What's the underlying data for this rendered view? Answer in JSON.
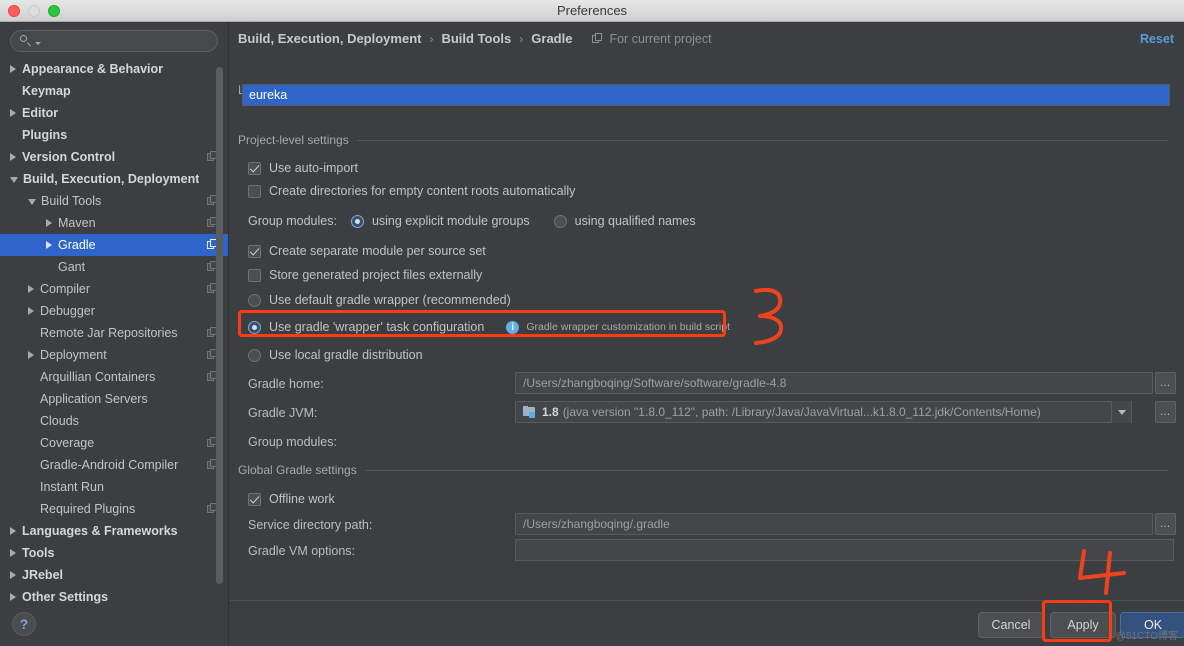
{
  "window": {
    "title": "Preferences",
    "traffic_lights": [
      "close",
      "minimize",
      "zoom"
    ]
  },
  "sidebar": {
    "search": {
      "value": "",
      "placeholder": ""
    },
    "items": [
      {
        "label": "Appearance & Behavior",
        "indent": 0,
        "arrow": "right",
        "bold": true,
        "badge": false,
        "selected": false
      },
      {
        "label": "Keymap",
        "indent": 0,
        "arrow": "none",
        "bold": true,
        "badge": false,
        "selected": false
      },
      {
        "label": "Editor",
        "indent": 0,
        "arrow": "right",
        "bold": true,
        "badge": false,
        "selected": false
      },
      {
        "label": "Plugins",
        "indent": 0,
        "arrow": "none",
        "bold": true,
        "badge": false,
        "selected": false
      },
      {
        "label": "Version Control",
        "indent": 0,
        "arrow": "right",
        "bold": true,
        "badge": true,
        "selected": false
      },
      {
        "label": "Build, Execution, Deployment",
        "indent": 0,
        "arrow": "down",
        "bold": true,
        "badge": false,
        "selected": false
      },
      {
        "label": "Build Tools",
        "indent": 1,
        "arrow": "down",
        "bold": false,
        "badge": true,
        "selected": false
      },
      {
        "label": "Maven",
        "indent": 2,
        "arrow": "right",
        "bold": false,
        "badge": true,
        "selected": false
      },
      {
        "label": "Gradle",
        "indent": 2,
        "arrow": "right",
        "bold": false,
        "badge": true,
        "selected": true
      },
      {
        "label": "Gant",
        "indent": 2,
        "arrow": "none",
        "bold": false,
        "badge": true,
        "selected": false
      },
      {
        "label": "Compiler",
        "indent": 1,
        "arrow": "right",
        "bold": false,
        "badge": true,
        "selected": false
      },
      {
        "label": "Debugger",
        "indent": 1,
        "arrow": "right",
        "bold": false,
        "badge": false,
        "selected": false
      },
      {
        "label": "Remote Jar Repositories",
        "indent": 1,
        "arrow": "none",
        "bold": false,
        "badge": true,
        "selected": false
      },
      {
        "label": "Deployment",
        "indent": 1,
        "arrow": "right",
        "bold": false,
        "badge": true,
        "selected": false
      },
      {
        "label": "Arquillian Containers",
        "indent": 1,
        "arrow": "none",
        "bold": false,
        "badge": true,
        "selected": false
      },
      {
        "label": "Application Servers",
        "indent": 1,
        "arrow": "none",
        "bold": false,
        "badge": false,
        "selected": false
      },
      {
        "label": "Clouds",
        "indent": 1,
        "arrow": "none",
        "bold": false,
        "badge": false,
        "selected": false
      },
      {
        "label": "Coverage",
        "indent": 1,
        "arrow": "none",
        "bold": false,
        "badge": true,
        "selected": false
      },
      {
        "label": "Gradle-Android Compiler",
        "indent": 1,
        "arrow": "none",
        "bold": false,
        "badge": true,
        "selected": false
      },
      {
        "label": "Instant Run",
        "indent": 1,
        "arrow": "none",
        "bold": false,
        "badge": false,
        "selected": false
      },
      {
        "label": "Required Plugins",
        "indent": 1,
        "arrow": "none",
        "bold": false,
        "badge": true,
        "selected": false
      },
      {
        "label": "Languages & Frameworks",
        "indent": 0,
        "arrow": "right",
        "bold": true,
        "badge": false,
        "selected": false
      },
      {
        "label": "Tools",
        "indent": 0,
        "arrow": "right",
        "bold": true,
        "badge": false,
        "selected": false
      },
      {
        "label": "JRebel",
        "indent": 0,
        "arrow": "right",
        "bold": true,
        "badge": false,
        "selected": false
      },
      {
        "label": "Other Settings",
        "indent": 0,
        "arrow": "right",
        "bold": true,
        "badge": false,
        "selected": false
      }
    ],
    "help_label": "?"
  },
  "header": {
    "crumbs": [
      "Build, Execution, Deployment",
      "Build Tools",
      "Gradle"
    ],
    "separator": "›",
    "for_current_project": "For current project",
    "reset_label": "Reset"
  },
  "main": {
    "linked_section_title": "Linked Gradle projects",
    "linked_projects": [
      "eureka"
    ],
    "project_section_title": "Project-level settings",
    "options": [
      {
        "type": "checkbox",
        "label": "Use auto-import",
        "checked": true
      },
      {
        "type": "checkbox",
        "label": "Create directories for empty content roots automatically",
        "checked": false
      }
    ],
    "group_modules_label": "Group modules:",
    "group_modules_options": [
      {
        "label": "using explicit module groups",
        "checked": true
      },
      {
        "label": "using qualified names",
        "checked": false
      }
    ],
    "options2": [
      {
        "type": "checkbox",
        "label": "Create separate module per source set",
        "checked": true
      },
      {
        "type": "checkbox",
        "label": "Store generated project files externally",
        "checked": false
      }
    ],
    "distribution_options": [
      {
        "label": "Use default gradle wrapper (recommended)",
        "checked": false
      },
      {
        "label": "Use gradle 'wrapper' task configuration",
        "checked": true
      },
      {
        "label": "Use local gradle distribution",
        "checked": false
      }
    ],
    "info_badge": {
      "icon": "info-icon",
      "text": "Gradle wrapper customization in build script"
    },
    "gradle_home_label": "Gradle home:",
    "gradle_home_value": "/Users/zhangboqing/Software/software/gradle-4.8",
    "gradle_jvm_label": "Gradle JVM:",
    "gradle_jvm_version": "1.8",
    "gradle_jvm_detail": "(java version \"1.8.0_112\", path: /Library/Java/JavaVirtual...k1.8.0_112.jdk/Contents/Home)",
    "group_modules_label2": "Group modules:",
    "global_section_title": "Global Gradle settings",
    "offline_work": {
      "label": "Offline work",
      "checked": true
    },
    "service_dir_label": "Service directory path:",
    "service_dir_value": "/Users/zhangboqing/.gradle",
    "vm_options_label": "Gradle VM options:",
    "vm_options_value": "",
    "ellipsis_label": "…"
  },
  "footer": {
    "cancel_label": "Cancel",
    "apply_label": "Apply",
    "ok_label": "OK",
    "watermark": "@51CTO博客"
  },
  "annotations": [
    {
      "mark": "3",
      "near": "gradle-wrapper-task-row"
    },
    {
      "mark": "4",
      "near": "apply-button"
    }
  ],
  "colors": {
    "accent_blue": "#2f65ca",
    "highlight_red": "#ff3b16",
    "link_blue": "#5b9bd8",
    "panel_bg": "#3c3f41"
  }
}
